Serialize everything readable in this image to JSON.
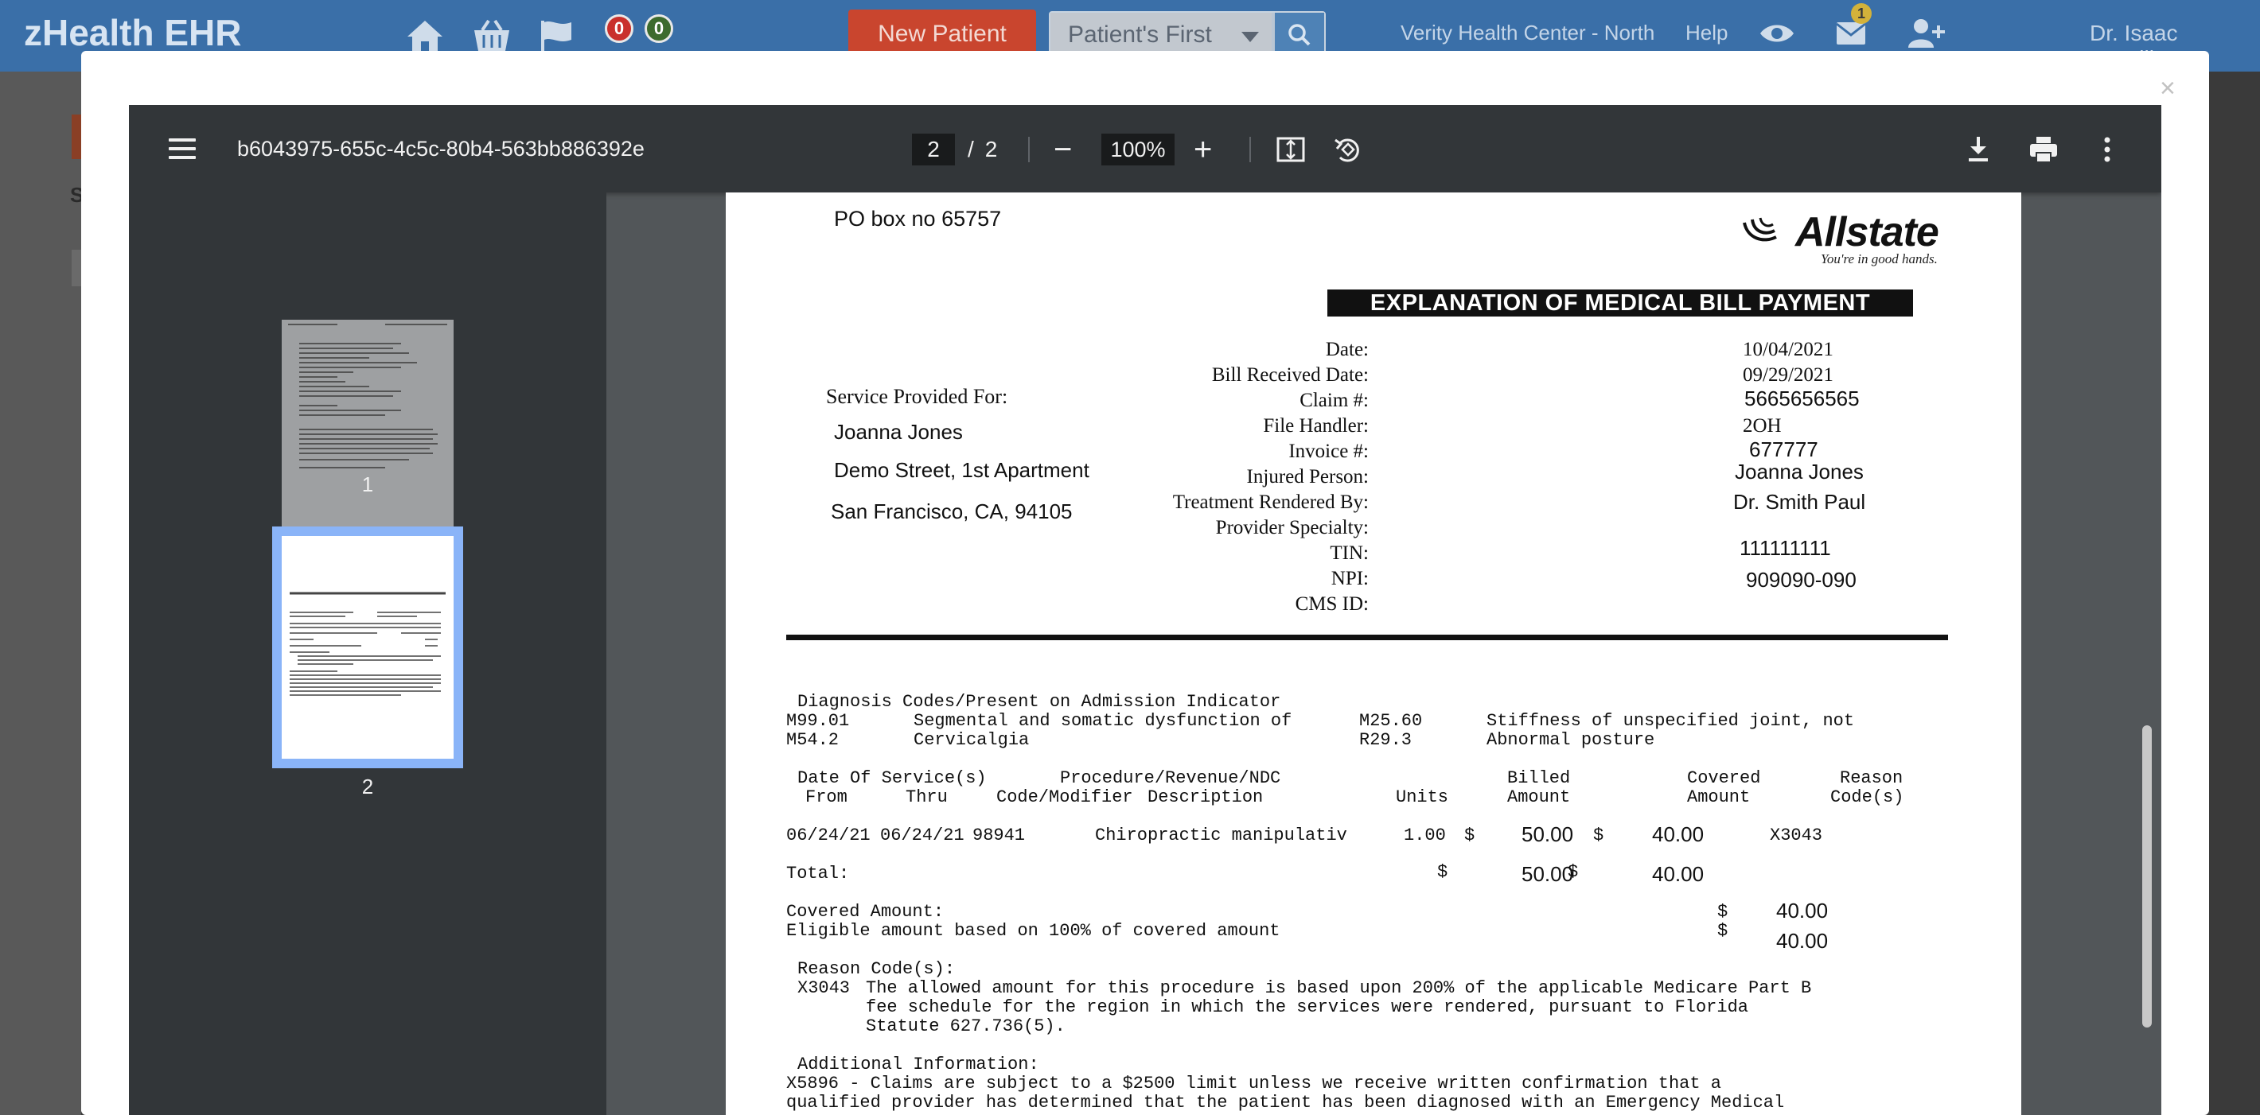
{
  "app": {
    "brand": "zHealth EHR",
    "notif_red": "0",
    "notif_green": "0",
    "new_patient_label": "New Patient",
    "search_scope": "Patient's First",
    "location": "Verity Health Center - North",
    "help_label": "Help",
    "message_count": "1",
    "user": "Dr. Isaac Montilla",
    "sidebar_letter": "S"
  },
  "modal": {
    "close_glyph": "×"
  },
  "viewer": {
    "filename": "b6043975-655c-4c5c-80b4-563bb886392e",
    "current_page": "2",
    "page_sep": "/",
    "total_pages": "2",
    "zoom": "100%",
    "zoom_out": "−",
    "zoom_in": "+",
    "thumbnails": [
      {
        "label": "1"
      },
      {
        "label": "2"
      }
    ]
  },
  "doc": {
    "po_box": "PO box no 65757",
    "insurer_logo": "Allstate",
    "insurer_tagline": "You're in good hands.",
    "title": "EXPLANATION OF MEDICAL BILL PAYMENT",
    "service_for_label": "Service  Provided  For:",
    "patient_name": "Joanna Jones",
    "address_line1": "Demo Street, 1st Apartment",
    "address_line2": "San Francisco, CA, 94105",
    "fields": [
      {
        "label": "Date:",
        "value": "10/04/2021"
      },
      {
        "label": "Bill Received Date:",
        "value": "09/29/2021"
      },
      {
        "label": "Claim #:",
        "value": "5665656565"
      },
      {
        "label": "File Handler:",
        "value": "2OH"
      },
      {
        "label": "Invoice #:",
        "value": "677777"
      },
      {
        "label": "Injured  Person:",
        "value": "Joanna Jones"
      },
      {
        "label": "Treatment  Rendered  By:",
        "value": "Dr. Smith Paul"
      },
      {
        "label": "Provider  Specialty:",
        "value": ""
      },
      {
        "label": "TIN:",
        "value": "111111111"
      },
      {
        "label": "NPI:",
        "value": "909090-090"
      },
      {
        "label": "CMS ID:",
        "value": ""
      }
    ],
    "diag_header": "Diagnosis Codes/Present on Admission Indicator",
    "diagnoses": [
      {
        "code": "M99.01",
        "desc": "Segmental and somatic dysfunction of",
        "code2": "M25.60",
        "desc2": "Stiffness of unspecified joint, not"
      },
      {
        "code": "M54.2",
        "desc": "Cervicalgia",
        "code2": "R29.3",
        "desc2": "Abnormal posture"
      }
    ],
    "th_dates": "Date Of Service(s)",
    "th_from": "From",
    "th_thru": "Thru",
    "th_proc": "Procedure/Revenue/NDC",
    "th_code": "Code/Modifier",
    "th_desc": "Description",
    "th_units": "Units",
    "th_billed1": "Billed",
    "th_billed2": "Amount",
    "th_covered1": "Covered",
    "th_covered2": "Amount",
    "th_reason1": "Reason",
    "th_reason2": "Code(s)",
    "line": {
      "from": "06/24/21",
      "thru": "06/24/21",
      "code": "98941",
      "desc": "Chiropractic manipulativ",
      "units": "1.00",
      "cur": "$",
      "billed": "50.00",
      "covered": "40.00",
      "reason": "X3043"
    },
    "total_label": "Total:",
    "total_billed": "50.00",
    "total_covered": "40.00",
    "covered_amount_label": "Covered Amount:",
    "covered_amount": "40.00",
    "eligible_label": "Eligible amount based on 100% of covered amount",
    "eligible_amount": "40.00",
    "reason_header": "Reason Code(s):",
    "reason_code": "X3043",
    "reason_text_1": "The allowed amount for this procedure is based upon 200% of the applicable Medicare Part B",
    "reason_text_2": "fee schedule for the region in which the services were rendered, pursuant to Florida",
    "reason_text_3": "Statute 627.736(5).",
    "additional_header": "Additional Information:",
    "additional_1": "X5896 - Claims are subject to a $2500 limit unless we receive written confirmation that a",
    "additional_2": "qualified provider has determined that the patient has been diagnosed with an Emergency Medical"
  }
}
